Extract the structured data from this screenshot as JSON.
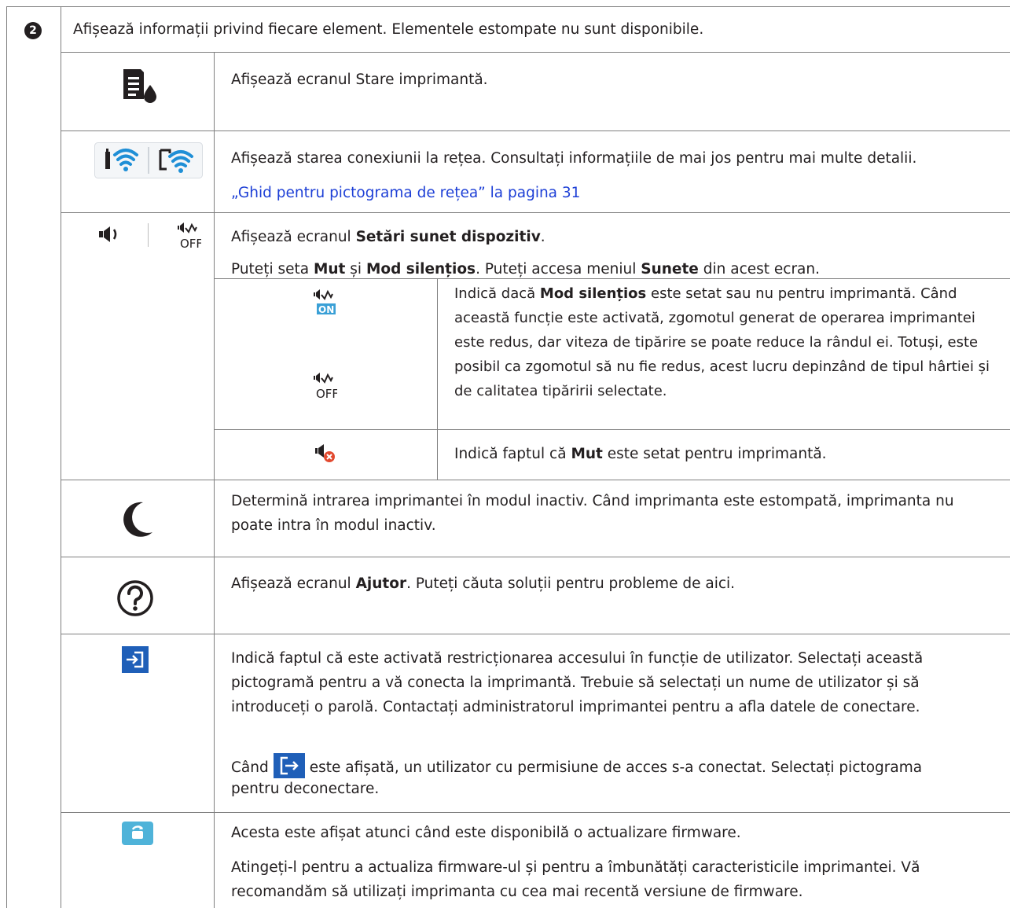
{
  "row_number": "2",
  "header_text": "Afișează informații privind fiecare element. Elementele estompate nu sunt disponibile.",
  "rows": {
    "printer_status": {
      "icon": "printer-status-ink-icon",
      "text": "Afișează ecranul Stare imprimantă."
    },
    "network": {
      "icon": "wifi-status-icons",
      "text": "Afișează starea conexiunii la rețea. Consultați informațiile de mai jos pentru mai multe detalii.",
      "link": "„Ghid pentru pictograma de rețea” la pagina 31"
    },
    "sound": {
      "icon_on_label": "",
      "icon_off_label": "OFF",
      "line1_pre": "Afișează ecranul ",
      "line1_bold": "Setări sunet dispozitiv",
      "line1_post": ".",
      "line2_a": "Puteți seta ",
      "line2_b": "Mut",
      "line2_c": " și ",
      "line2_d": "Mod silențios",
      "line2_e": ". Puteți accesa meniul ",
      "line2_f": "Sunete",
      "line2_g": " din acest ecran.",
      "quiet": {
        "icon_on": "ON",
        "icon_off": "OFF",
        "t_pre": "Indică dacă ",
        "t_bold": "Mod silențios",
        "t_post": " este setat sau nu pentru imprimantă. Când această funcție este activată, zgomotul generat de operarea imprimantei este redus, dar viteza de tipărire se poate reduce la rândul ei. Totuși, este posibil ca zgomotul să nu fie redus, acest lucru depinzând de tipul hârtiei și de calitatea tipăririi selectate."
      },
      "mute": {
        "t_pre": "Indică faptul că ",
        "t_bold": "Mut",
        "t_post": " este setat pentru imprimantă."
      }
    },
    "sleep": {
      "icon": "moon-icon",
      "text": "Determină intrarea imprimantei în modul inactiv. Când imprimanta este estompată, imprimanta nu poate intra în modul inactiv."
    },
    "help": {
      "icon": "help-question-icon",
      "t_pre": "Afișează ecranul ",
      "t_bold": "Ajutor",
      "t_post": ". Puteți căuta soluții pentru probleme de aici."
    },
    "login": {
      "icon": "login-icon",
      "text": "Indică faptul că este activată restricționarea accesului în funcție de utilizator. Selectați această pictogramă pentru a vă conecta la imprimantă. Trebuie să selectați un nume de utilizator și să introduceți o parolă. Contactați administratorul imprimantei pentru a afla datele de conectare.",
      "t2_pre": "Când",
      "t2_post": "este afișată, un utilizator cu permisiune de acces s-a conectat. Selectați pictograma",
      "t2_line2": "pentru deconectare."
    },
    "firmware": {
      "icon": "firmware-update-icon",
      "text1": "Acesta este afișat atunci când este disponibilă o actualizare firmware.",
      "text2": "Atingeți-l pentru a actualiza firmware-ul și pentru a îmbunătăți caracteristicile imprimantei. Vă recomandăm să utilizați imprimanta cu cea mai recentă versiune de firmware."
    }
  },
  "colors": {
    "border": "#7f7f7f",
    "link": "#1d3fd6",
    "icon_blue": "#1f5fb8",
    "icon_cyan": "#4fb3d9",
    "mute_red": "#e2492f"
  }
}
